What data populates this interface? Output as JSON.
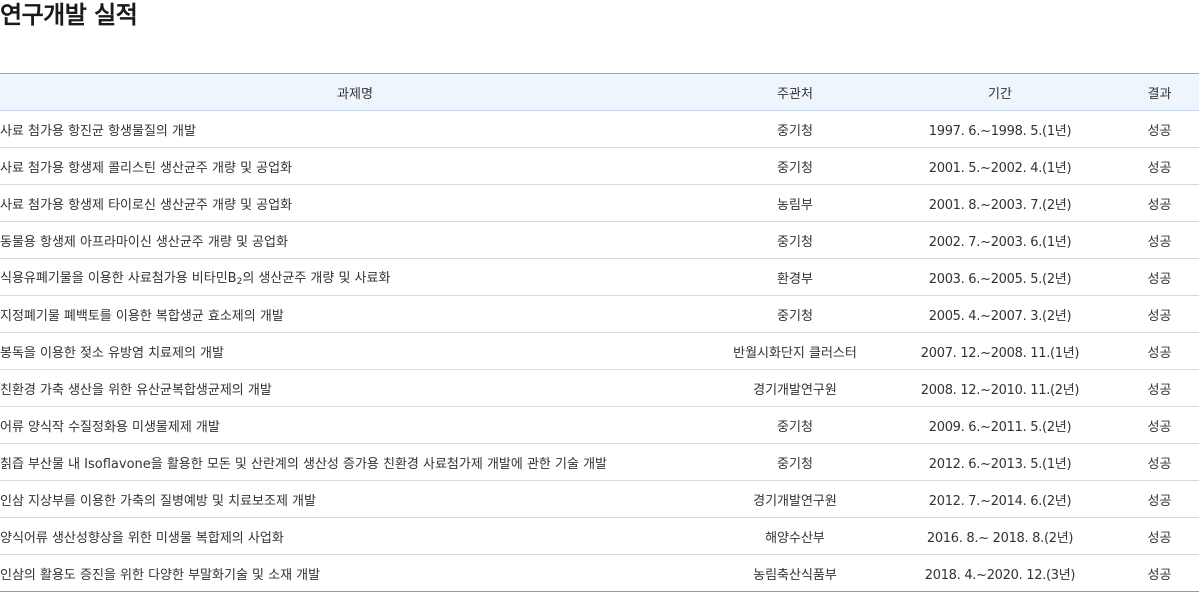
{
  "page_title": "연구개발 실적",
  "table": {
    "headers": {
      "title": "과제명",
      "org": "주관처",
      "period": "기간",
      "result": "결과"
    },
    "rows": [
      {
        "title": "사료 첨가용 항진균 항생물질의 개발",
        "org": "중기청",
        "period": "1997. 6.~1998. 5.(1년)",
        "result": "성공"
      },
      {
        "title": "사료 첨가용 항생제 콜리스틴 생산균주 개량 및 공업화",
        "org": "중기청",
        "period": "2001. 5.~2002. 4.(1년)",
        "result": "성공"
      },
      {
        "title": "사료 첨가용 항생제 타이로신 생산균주 개량 및 공업화",
        "org": "농림부",
        "period": "2001. 8.~2003. 7.(2년)",
        "result": "성공"
      },
      {
        "title": "동물용 항생제 아프라마이신 생산균주 개량 및 공업화",
        "org": "중기청",
        "period": "2002. 7.~2003. 6.(1년)",
        "result": "성공"
      },
      {
        "title": "식용유폐기물을 이용한 사료첨가용 비타민B",
        "title_sub": "2",
        "title_rest": "의 생산균주 개량 및 사료화",
        "org": "환경부",
        "period": "2003. 6.~2005. 5.(2년)",
        "result": "성공"
      },
      {
        "title": "지정폐기물 폐백토를 이용한 복합생균 효소제의 개발",
        "org": "중기청",
        "period": "2005. 4.~2007. 3.(2년)",
        "result": "성공"
      },
      {
        "title": "봉독을 이용한 젖소 유방염 치료제의 개발",
        "org": "반월시화단지 클러스터",
        "period": "2007. 12.~2008. 11.(1년)",
        "result": "성공"
      },
      {
        "title": "친환경 가축 생산을 위한 유산균복합생균제의 개발",
        "org": "경기개발연구원",
        "period": "2008. 12.~2010. 11.(2년)",
        "result": "성공"
      },
      {
        "title": "어류 양식작 수질정화용 미생물제제 개발",
        "org": "중기청",
        "period": "2009. 6.~2011. 5.(2년)",
        "result": "성공"
      },
      {
        "title": "칡즙 부산물 내 Isoflavone을 활용한 모돈 및 산란계의 생산성 증가용 친환경 사료첨가제 개발에 관한 기술 개발",
        "org": "중기청",
        "period": "2012. 6.~2013. 5.(1년)",
        "result": "성공"
      },
      {
        "title": "인삼 지상부를 이용한 가축의 질병예방 및 치료보조제 개발",
        "org": "경기개발연구원",
        "period": "2012. 7.~2014. 6.(2년)",
        "result": "성공"
      },
      {
        "title": "양식어류 생산성향상을 위한 미생물 복합제의 사업화",
        "org": "해양수산부",
        "period": "2016. 8.~ 2018. 8.(2년)",
        "result": "성공"
      },
      {
        "title": "인삼의 활용도 증진을 위한 다양한 부말화기술 및 소재 개발",
        "org": "농림축산식품부",
        "period": "2018. 4.~2020. 12.(3년)",
        "result": "성공"
      }
    ]
  }
}
